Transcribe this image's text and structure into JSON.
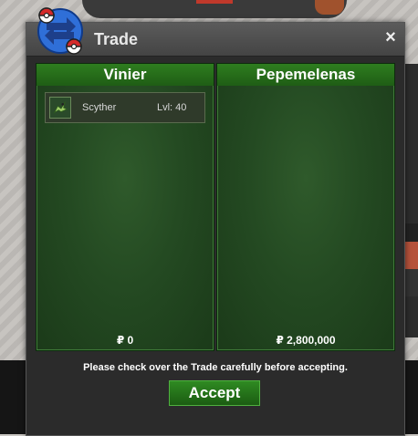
{
  "window": {
    "title": "Trade",
    "close_label": "×"
  },
  "left_panel": {
    "player_name": "Vinier",
    "items": [
      {
        "name": "Scyther",
        "level": "Lvl: 40",
        "icon": "scyther-icon"
      }
    ],
    "money": "₽ 0"
  },
  "right_panel": {
    "player_name": "Pepemelenas",
    "items": [],
    "money": "₽ 2,800,000"
  },
  "footer": {
    "notice": "Please check over the Trade carefully before accepting.",
    "accept_label": "Accept"
  },
  "colors": {
    "panel_green": "#244a22",
    "header_green": "#2e7d1f",
    "window_bg": "#2b2b2b"
  }
}
